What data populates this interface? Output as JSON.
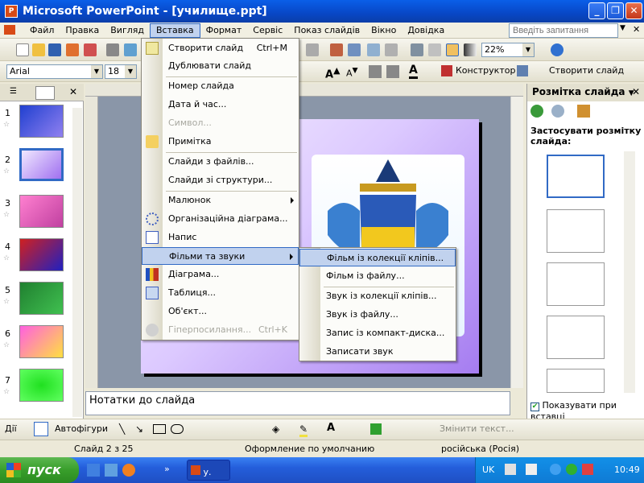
{
  "window": {
    "title": "Microsoft PowerPoint - [училище.ppt]",
    "app_icon": "powerpoint-icon"
  },
  "menubar": {
    "items": [
      "Файл",
      "Правка",
      "Вигляд",
      "Вставка",
      "Формат",
      "Сервіс",
      "Показ слайдів",
      "Вікно",
      "Довідка"
    ],
    "active": "Вставка"
  },
  "askbox": {
    "placeholder": "Введіть запитання"
  },
  "toolbar_format": {
    "font": "Arial",
    "size": "18",
    "zoom": "22%",
    "designer": "Конструктор",
    "new_slide": "Створити слайд"
  },
  "insert_menu": {
    "items": [
      {
        "label": "Створити слайд",
        "shortcut": "Ctrl+M",
        "icon": "new-slide-icon"
      },
      {
        "label": "Дублювати слайд"
      },
      {
        "label": "Номер слайда"
      },
      {
        "label": "Дата й час..."
      },
      {
        "label": "Символ...",
        "disabled": true
      },
      {
        "label": "Примітка",
        "icon": "comment-icon"
      },
      {
        "label": "Слайди з файлів..."
      },
      {
        "label": "Слайди зі структури..."
      },
      {
        "label": "Малюнок",
        "submenu": true
      },
      {
        "label": "Організаційна діаграма...",
        "icon": "org-chart-icon"
      },
      {
        "label": "Напис",
        "icon": "textbox-icon"
      },
      {
        "label": "Фільми та звуки",
        "submenu": true,
        "highlighted": true
      },
      {
        "label": "Діаграма...",
        "icon": "chart-icon"
      },
      {
        "label": "Таблиця...",
        "icon": "table-icon"
      },
      {
        "label": "Об'єкт..."
      },
      {
        "label": "Гіперпосилання...",
        "shortcut": "Ctrl+K",
        "disabled": true,
        "icon": "hyperlink-icon"
      }
    ]
  },
  "movies_submenu": {
    "items": [
      "Фільм із колекції кліпів...",
      "Фільм із файлу...",
      "Звук із колекції кліпів...",
      "Звук із файлу...",
      "Запис із компакт-диска...",
      "Записати звук"
    ],
    "highlighted": "Фільм із колекції кліпів..."
  },
  "slides_pane": {
    "numbers": [
      "1",
      "2",
      "3",
      "4",
      "5",
      "6",
      "7"
    ],
    "selected": "2"
  },
  "notes": {
    "placeholder": "Нотатки до слайда"
  },
  "task_pane": {
    "title": "Розмітка слайда",
    "heading": "Застосувати розмітку слайда:",
    "checkbox": "Показувати при вставці"
  },
  "drawbar": {
    "actions": "Дії",
    "autoshapes": "Автофігури",
    "change_text": "Змінити текст..."
  },
  "status": {
    "slide": "Слайд 2 з 25",
    "design": "Оформление по умолчанию",
    "language": "російська (Росія)"
  },
  "taskbar": {
    "start": "пуск",
    "task": "у.",
    "lang": "UK",
    "time": "10:49"
  },
  "colors": {
    "accent": "#316ac5",
    "highlight": "#c1d2ee",
    "slide_purple": "#a57cf0"
  }
}
